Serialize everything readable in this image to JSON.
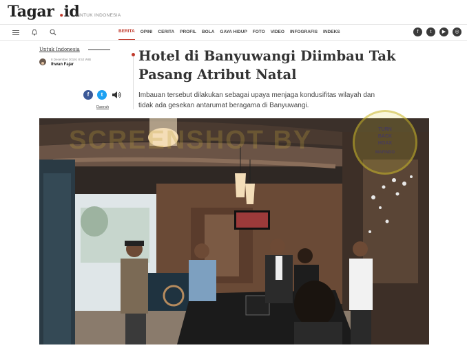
{
  "header": {
    "logo_main": "Tagar",
    "logo_dot": " .",
    "logo_tld": "id",
    "tagline": "UNTUK INDONESIA"
  },
  "nav": {
    "items": [
      "BERITA",
      "OPINI",
      "CERITA",
      "PROFIL",
      "BOLA",
      "GAYA HIDUP",
      "FOTO",
      "VIDEO",
      "INFOGRAFIS",
      "INDEKS"
    ],
    "active": "BERITA"
  },
  "social_icons": [
    "f",
    "t",
    "▶",
    "◎"
  ],
  "article": {
    "channel": "Untuk Indonesia",
    "date": "8 Desember 2019 | 8:52 WIB",
    "author": "Ihwan Fajar",
    "title": "Hotel di Banyuwangi Diimbau Tak Pasang Atribut Natal",
    "lead": "Imbauan tersebut dilakukan sebagai upaya menjaga kondusifitas wilayah dan tidak ada gesekan antarumat beragama di Banyuwangi.",
    "region_tag": "Daerah"
  },
  "watermark": "SCREENSHOT BY",
  "stamp": {
    "line1": "TURN",
    "line2": "BACK",
    "line3": "HOAX",
    "line4": "MAFINDO"
  },
  "colors": {
    "accent": "#c0392b",
    "facebook": "#3b5998",
    "twitter": "#1da1f2"
  }
}
